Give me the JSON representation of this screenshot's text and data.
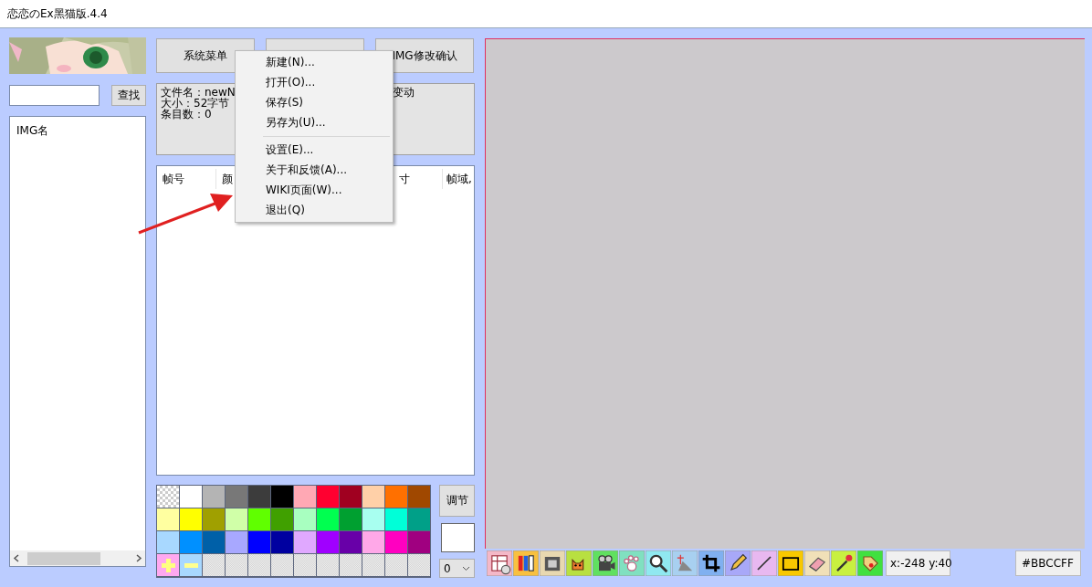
{
  "window": {
    "title": "恋恋のEx黑猫版.4.4"
  },
  "sidebar": {
    "search_button": "查找",
    "list_header": "IMG名"
  },
  "top_buttons": [
    {
      "kind": "labeled",
      "label": "系统菜单"
    },
    {
      "kind": "blank"
    },
    {
      "kind": "labeled",
      "label": "IMG修改确认"
    }
  ],
  "file_info": {
    "lines": [
      "文件名：newN",
      "大小：52字节",
      "条目数：0"
    ],
    "column_2": "变动"
  },
  "frame_table": {
    "columns": [
      "帧号",
      "颜",
      "寸",
      "帧域,"
    ]
  },
  "palette": {
    "cells": [
      {
        "kind": "transparent"
      },
      {
        "kind": "color",
        "color": "#ffffff"
      },
      {
        "kind": "color",
        "color": "#b4b4b4"
      },
      {
        "kind": "color",
        "color": "#787878"
      },
      {
        "kind": "color",
        "color": "#3c3c3c"
      },
      {
        "kind": "color",
        "color": "#000000"
      },
      {
        "kind": "color",
        "color": "#ffa8b4"
      },
      {
        "kind": "color",
        "color": "#ff0030"
      },
      {
        "kind": "color",
        "color": "#a00020"
      },
      {
        "kind": "color",
        "color": "#ffd0a8"
      },
      {
        "kind": "color",
        "color": "#ff7000"
      },
      {
        "kind": "color",
        "color": "#a04800"
      },
      {
        "kind": "color",
        "color": "#ffffa0"
      },
      {
        "kind": "color",
        "color": "#ffff00"
      },
      {
        "kind": "color",
        "color": "#a0a000"
      },
      {
        "kind": "color",
        "color": "#d0ffa8"
      },
      {
        "kind": "color",
        "color": "#60ff00"
      },
      {
        "kind": "color",
        "color": "#40a000"
      },
      {
        "kind": "color",
        "color": "#a8ffc0"
      },
      {
        "kind": "color",
        "color": "#00ff50"
      },
      {
        "kind": "color",
        "color": "#00a030"
      },
      {
        "kind": "color",
        "color": "#a8fff0"
      },
      {
        "kind": "color",
        "color": "#00ffd8"
      },
      {
        "kind": "color",
        "color": "#00a088"
      },
      {
        "kind": "color",
        "color": "#a8d8ff"
      },
      {
        "kind": "color",
        "color": "#0090ff"
      },
      {
        "kind": "color",
        "color": "#0060a8"
      },
      {
        "kind": "color",
        "color": "#a8a8ff"
      },
      {
        "kind": "color",
        "color": "#0000ff"
      },
      {
        "kind": "color",
        "color": "#0000a0"
      },
      {
        "kind": "color",
        "color": "#e0a8ff"
      },
      {
        "kind": "color",
        "color": "#a000ff"
      },
      {
        "kind": "color",
        "color": "#6800a8"
      },
      {
        "kind": "color",
        "color": "#ffa8e8"
      },
      {
        "kind": "color",
        "color": "#ff00c0"
      },
      {
        "kind": "color",
        "color": "#a00080"
      },
      {
        "kind": "add"
      },
      {
        "kind": "remove"
      },
      {
        "kind": "empty"
      },
      {
        "kind": "empty"
      },
      {
        "kind": "empty"
      },
      {
        "kind": "empty"
      },
      {
        "kind": "empty"
      },
      {
        "kind": "empty"
      },
      {
        "kind": "empty"
      },
      {
        "kind": "empty"
      },
      {
        "kind": "empty"
      },
      {
        "kind": "empty"
      }
    ],
    "adjust_button": "调节",
    "layer_select": {
      "value": "0"
    }
  },
  "status": {
    "coordinates": "x:-248 y:40",
    "color_code": "#BBCCFF"
  },
  "menu": {
    "items": [
      {
        "kind": "item",
        "label": "新建(N)..."
      },
      {
        "kind": "item",
        "label": "打开(O)..."
      },
      {
        "kind": "item",
        "label": "保存(S)"
      },
      {
        "kind": "item",
        "label": "另存为(U)..."
      },
      {
        "kind": "separator"
      },
      {
        "kind": "item",
        "label": "设置(E)..."
      },
      {
        "kind": "item",
        "label": "关于和反馈(A)..."
      },
      {
        "kind": "item",
        "label": "WIKI页面(W)..."
      },
      {
        "kind": "item",
        "label": "退出(Q)"
      }
    ]
  }
}
